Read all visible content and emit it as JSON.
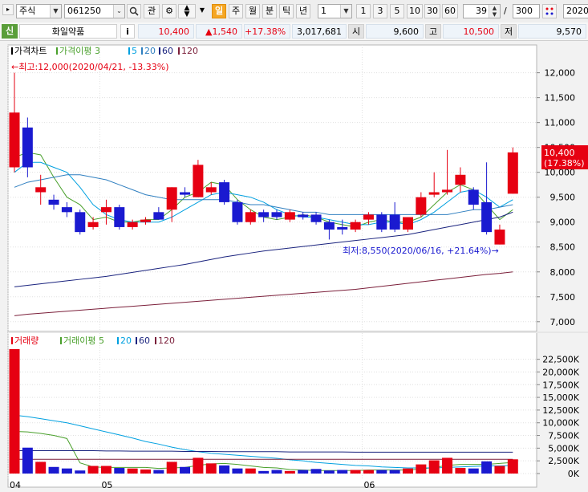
{
  "toolbar": {
    "market": "주식",
    "code": "061250",
    "fav_label": "관",
    "periods": [
      "일",
      "주",
      "월",
      "분",
      "틱",
      "년"
    ],
    "active_period": "일",
    "interval_value": "1",
    "quick_intervals": [
      "1",
      "3",
      "5",
      "10",
      "30",
      "60"
    ],
    "count_value": "39",
    "slash": "/",
    "total_value": "300",
    "date_value": "2020/"
  },
  "quote": {
    "badge": "신",
    "name": "화일약품",
    "info_label": "i",
    "price": "10,400",
    "change": "▲1,540",
    "change_pct": "+17.38%",
    "volume": "3,017,681",
    "open_label": "시",
    "open": "9,600",
    "high_label": "고",
    "high": "10,500",
    "low_label": "저",
    "low": "9,570"
  },
  "colors": {
    "up": "#e60012",
    "down": "#1a1ad0",
    "ma3": "#4aa02c",
    "ma5": "#00a0e0",
    "ma20": "#2f7fc0",
    "ma60": "#1a237e",
    "ma120": "#7b1f3a"
  },
  "chart_data": [
    {
      "type": "candlestick",
      "legend": [
        {
          "label": "가격차트",
          "color": "#000000"
        },
        {
          "label": "가격이평 3",
          "color": "#4aa02c"
        },
        {
          "label": "5",
          "color": "#00a0e0"
        },
        {
          "label": "20",
          "color": "#2f7fc0"
        },
        {
          "label": "60",
          "color": "#1a237e"
        },
        {
          "label": "120",
          "color": "#7b1f3a"
        }
      ],
      "ylim": [
        6900,
        12300
      ],
      "yticks": [
        {
          "v": 12000,
          "label": "12,000"
        },
        {
          "v": 11500,
          "label": "11,500"
        },
        {
          "v": 11000,
          "label": "11,000"
        },
        {
          "v": 10500,
          "label": "10,500"
        },
        {
          "v": 10000,
          "label": "10,000"
        },
        {
          "v": 9500,
          "label": "9,500"
        },
        {
          "v": 9000,
          "label": "9,000"
        },
        {
          "v": 8500,
          "label": "8,500"
        },
        {
          "v": 8000,
          "label": "8,000"
        },
        {
          "v": 7500,
          "label": "7,500"
        },
        {
          "v": 7000,
          "label": "7,000"
        }
      ],
      "candles": [
        {
          "o": 10100,
          "h": 12000,
          "l": 10000,
          "c": 11200
        },
        {
          "o": 10900,
          "h": 11100,
          "l": 9900,
          "c": 10100
        },
        {
          "o": 9600,
          "h": 9950,
          "l": 9350,
          "c": 9700
        },
        {
          "o": 9450,
          "h": 9550,
          "l": 9250,
          "c": 9350
        },
        {
          "o": 9300,
          "h": 9400,
          "l": 9100,
          "c": 9200
        },
        {
          "o": 9200,
          "h": 9250,
          "l": 8750,
          "c": 8800
        },
        {
          "o": 8900,
          "h": 9100,
          "l": 8850,
          "c": 9000
        },
        {
          "o": 9200,
          "h": 9450,
          "l": 8950,
          "c": 9300
        },
        {
          "o": 9300,
          "h": 9350,
          "l": 8850,
          "c": 8900
        },
        {
          "o": 8900,
          "h": 9050,
          "l": 8850,
          "c": 9000
        },
        {
          "o": 9000,
          "h": 9100,
          "l": 8950,
          "c": 9050
        },
        {
          "o": 9200,
          "h": 9300,
          "l": 9050,
          "c": 9050
        },
        {
          "o": 9250,
          "h": 9700,
          "l": 9000,
          "c": 9700
        },
        {
          "o": 9600,
          "h": 9700,
          "l": 9500,
          "c": 9550
        },
        {
          "o": 9500,
          "h": 10250,
          "l": 9500,
          "c": 10150
        },
        {
          "o": 9600,
          "h": 9800,
          "l": 9550,
          "c": 9700
        },
        {
          "o": 9800,
          "h": 9850,
          "l": 9350,
          "c": 9400
        },
        {
          "o": 9400,
          "h": 9450,
          "l": 8950,
          "c": 9000
        },
        {
          "o": 9000,
          "h": 9250,
          "l": 8950,
          "c": 9200
        },
        {
          "o": 9200,
          "h": 9250,
          "l": 9000,
          "c": 9100
        },
        {
          "o": 9200,
          "h": 9250,
          "l": 9050,
          "c": 9100
        },
        {
          "o": 9050,
          "h": 9250,
          "l": 9000,
          "c": 9200
        },
        {
          "o": 9150,
          "h": 9200,
          "l": 9050,
          "c": 9100
        },
        {
          "o": 9150,
          "h": 9200,
          "l": 8950,
          "c": 9000
        },
        {
          "o": 9000,
          "h": 9050,
          "l": 8650,
          "c": 8850
        },
        {
          "o": 8900,
          "h": 9050,
          "l": 8750,
          "c": 8850
        },
        {
          "o": 8850,
          "h": 9050,
          "l": 8800,
          "c": 9000
        },
        {
          "o": 9050,
          "h": 9200,
          "l": 8950,
          "c": 9150
        },
        {
          "o": 9150,
          "h": 9200,
          "l": 8800,
          "c": 8850
        },
        {
          "o": 9150,
          "h": 9400,
          "l": 8800,
          "c": 8850
        },
        {
          "o": 8850,
          "h": 9100,
          "l": 8800,
          "c": 9100
        },
        {
          "o": 9150,
          "h": 9600,
          "l": 9100,
          "c": 9500
        },
        {
          "o": 9550,
          "h": 10000,
          "l": 9500,
          "c": 9600
        },
        {
          "o": 9600,
          "h": 10450,
          "l": 9550,
          "c": 9650
        },
        {
          "o": 9750,
          "h": 10100,
          "l": 9600,
          "c": 9950
        },
        {
          "o": 9650,
          "h": 9700,
          "l": 9250,
          "c": 9350
        },
        {
          "o": 9400,
          "h": 10200,
          "l": 8750,
          "c": 8800
        },
        {
          "o": 8550,
          "h": 8950,
          "l": 8550,
          "c": 8850
        },
        {
          "o": 9570,
          "h": 10500,
          "l": 9570,
          "c": 10400
        }
      ],
      "ma": [
        {
          "name": "3",
          "color": "#4aa02c",
          "values": [
            10300,
            10400,
            10350,
            9900,
            9500,
            9350,
            9050,
            9100,
            9000,
            9000,
            9050,
            9050,
            9250,
            9500,
            9600,
            9800,
            9750,
            9450,
            9250,
            9100,
            9050,
            9100,
            9150,
            9100,
            9000,
            8950,
            8900,
            9000,
            9050,
            9000,
            9000,
            9100,
            9350,
            9600,
            9750,
            9650,
            9350,
            9050,
            9250
          ]
        },
        {
          "name": "5",
          "color": "#00a0e0",
          "values": [
            10000,
            10200,
            10200,
            10100,
            10000,
            9700,
            9350,
            9150,
            9050,
            9000,
            9000,
            9000,
            9100,
            9250,
            9400,
            9550,
            9600,
            9550,
            9500,
            9400,
            9250,
            9150,
            9100,
            9100,
            9050,
            9000,
            8950,
            8950,
            9000,
            9000,
            8950,
            9050,
            9200,
            9400,
            9600,
            9650,
            9500,
            9300,
            9450
          ]
        },
        {
          "name": "20",
          "color": "#2f7fc0",
          "values": [
            9700,
            9800,
            9850,
            9900,
            9950,
            9950,
            9900,
            9850,
            9750,
            9650,
            9550,
            9500,
            9450,
            9450,
            9450,
            9450,
            9450,
            9400,
            9350,
            9350,
            9300,
            9250,
            9200,
            9200,
            9150,
            9150,
            9150,
            9150,
            9150,
            9150,
            9150,
            9150,
            9150,
            9150,
            9200,
            9250,
            9250,
            9300,
            9350
          ]
        },
        {
          "name": "60",
          "color": "#1a237e",
          "values": [
            7700,
            7730,
            7760,
            7790,
            7820,
            7850,
            7880,
            7910,
            7950,
            7990,
            8030,
            8070,
            8110,
            8150,
            8200,
            8250,
            8300,
            8340,
            8380,
            8420,
            8450,
            8480,
            8510,
            8540,
            8570,
            8600,
            8630,
            8660,
            8690,
            8720,
            8750,
            8800,
            8850,
            8900,
            8950,
            9000,
            9050,
            9100,
            9200
          ]
        },
        {
          "name": "120",
          "color": "#7b1f3a",
          "values": [
            7120,
            7150,
            7170,
            7190,
            7210,
            7230,
            7250,
            7270,
            7290,
            7310,
            7330,
            7350,
            7370,
            7390,
            7410,
            7430,
            7450,
            7470,
            7490,
            7510,
            7530,
            7550,
            7570,
            7590,
            7610,
            7630,
            7650,
            7680,
            7710,
            7740,
            7770,
            7800,
            7830,
            7860,
            7890,
            7920,
            7950,
            7970,
            8000
          ]
        }
      ],
      "annotations": {
        "high": "←최고:12,000(2020/04/21, -13.33%)",
        "low": "최저:8,550(2020/06/16, +21.64%)→",
        "last_price": "10,400",
        "last_pct": "(17.38%)"
      }
    },
    {
      "type": "bar",
      "legend": [
        {
          "label": "거래량",
          "color": "#e60012"
        },
        {
          "label": "거래이평 5",
          "color": "#4aa02c"
        },
        {
          "label": "20",
          "color": "#00a0e0"
        },
        {
          "label": "60",
          "color": "#1a237e"
        },
        {
          "label": "120",
          "color": "#7b1f3a"
        }
      ],
      "ylim": [
        0,
        24500
      ],
      "yticks": [
        {
          "v": 22500,
          "label": "22,500K"
        },
        {
          "v": 20000,
          "label": "20,000K"
        },
        {
          "v": 17500,
          "label": "17,500K"
        },
        {
          "v": 15000,
          "label": "15,000K"
        },
        {
          "v": 12500,
          "label": "12,500K"
        },
        {
          "v": 10000,
          "label": "10,000K"
        },
        {
          "v": 7500,
          "label": "7,500K"
        },
        {
          "v": 5000,
          "label": "5,000K"
        },
        {
          "v": 2500,
          "label": "2,500K"
        },
        {
          "v": 0,
          "label": "0K"
        }
      ],
      "values": [
        24500,
        5100,
        2300,
        1300,
        1000,
        600,
        1500,
        1500,
        1100,
        1000,
        800,
        700,
        2300,
        1300,
        3100,
        2000,
        1600,
        1000,
        1000,
        500,
        700,
        500,
        700,
        900,
        600,
        700,
        700,
        700,
        700,
        700,
        1000,
        1800,
        2600,
        3100,
        1100,
        1000,
        2400,
        1500,
        2800
      ],
      "ma": [
        {
          "name": "5",
          "color": "#4aa02c",
          "values": [
            8300,
            8200,
            7900,
            7500,
            6900,
            2100,
            1300,
            1200,
            1200,
            1200,
            1200,
            1000,
            1100,
            1200,
            1600,
            1900,
            2000,
            1800,
            1500,
            1200,
            1100,
            800,
            700,
            600,
            600,
            600,
            600,
            700,
            700,
            700,
            700,
            900,
            1200,
            1600,
            1800,
            1800,
            1800,
            2000,
            2200
          ]
        },
        {
          "name": "20",
          "color": "#00a0e0",
          "values": [
            11500,
            11200,
            10800,
            10400,
            10000,
            9400,
            8800,
            8200,
            7600,
            7000,
            6300,
            5800,
            5200,
            4700,
            4300,
            4000,
            3800,
            3600,
            3400,
            3200,
            3000,
            2700,
            2500,
            2200,
            2000,
            1800,
            1600,
            1500,
            1300,
            1200,
            1100,
            1100,
            1100,
            1200,
            1300,
            1400,
            1500,
            1500,
            1600
          ]
        },
        {
          "name": "60",
          "color": "#1a237e",
          "values": [
            4500,
            4500,
            4500,
            4500,
            4500,
            4500,
            4500,
            4450,
            4450,
            4400,
            4400,
            4400,
            4400,
            4350,
            4350,
            4350,
            4300,
            4300,
            4300,
            4300,
            4300,
            4250,
            4250,
            4250,
            4250,
            4250,
            4200,
            4200,
            4200,
            4200,
            4200,
            4200,
            4200,
            4200,
            4200,
            4200,
            4200,
            4200,
            4200
          ]
        },
        {
          "name": "120",
          "color": "#7b1f3a",
          "values": [
            2800,
            2800,
            2800,
            2800,
            2800,
            2800,
            2800,
            2800,
            2800,
            2800,
            2800,
            2800,
            2800,
            2800,
            2800,
            2800,
            2800,
            2800,
            2800,
            2800,
            2800,
            2800,
            2800,
            2800,
            2800,
            2800,
            2800,
            2800,
            2800,
            2800,
            2800,
            2800,
            2800,
            2800,
            2800,
            2800,
            2800,
            2800,
            2800
          ]
        }
      ],
      "xlabels": [
        {
          "i": 0,
          "label": "04"
        },
        {
          "i": 7,
          "label": "05"
        },
        {
          "i": 27,
          "label": "06"
        }
      ]
    }
  ]
}
